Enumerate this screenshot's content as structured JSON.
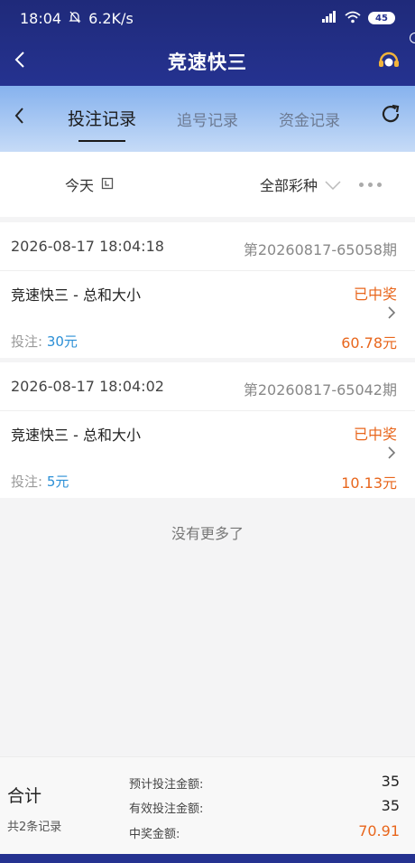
{
  "status_bar": {
    "time": "18:04",
    "speed": "6.2K/s",
    "battery": "45"
  },
  "header": {
    "title": "竞速快三"
  },
  "tabs": [
    {
      "label": "投注记录"
    },
    {
      "label": "追号记录"
    },
    {
      "label": "资金记录"
    }
  ],
  "filters": {
    "date": "今天",
    "lottery": "全部彩种"
  },
  "records": [
    {
      "time": "2026-08-17 18:04:18",
      "issue": "第20260817-65058期",
      "game": "竞速快三 - 总和大小",
      "status": "已中奖",
      "bet_label": "投注:",
      "bet_amount": "30元",
      "win": "60.78元"
    },
    {
      "time": "2026-08-17 18:04:02",
      "issue": "第20260817-65042期",
      "game": "竞速快三 - 总和大小",
      "status": "已中奖",
      "bet_label": "投注:",
      "bet_amount": "5元",
      "win": "10.13元"
    }
  ],
  "no_more": "没有更多了",
  "summary": {
    "title": "合计",
    "count": "共2条记录",
    "expected_label": "预计投注金额:",
    "expected_value": "35",
    "valid_label": "有效投注金额:",
    "valid_value": "35",
    "win_label": "中奖金额:",
    "win_value": "70.91"
  },
  "colors": {
    "header_bg": "#253290",
    "accent_orange": "#e8661c",
    "bet_blue": "#2b8fd6"
  }
}
